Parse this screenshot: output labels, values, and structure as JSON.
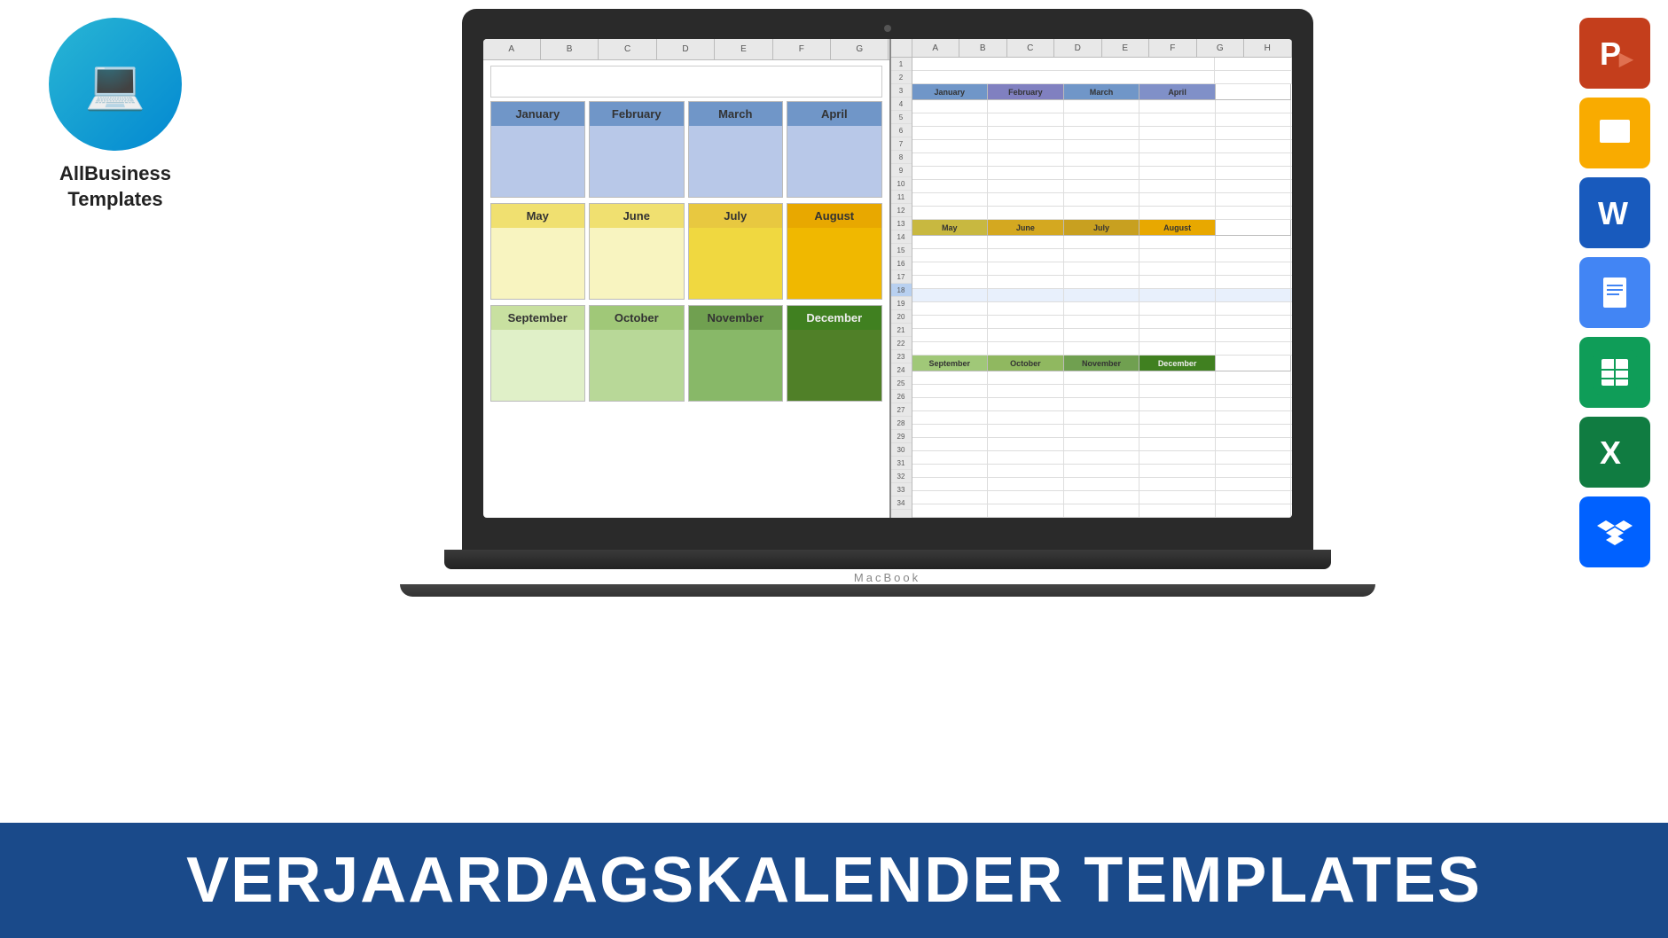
{
  "page": {
    "background": "#ffffff"
  },
  "logo": {
    "circle_color": "#29b6d4",
    "brand_line1": "AllBusiness",
    "brand_line2": "Templates"
  },
  "banner": {
    "text": "VERJAARDAGSKALENDER TEMPLATES"
  },
  "macbook": {
    "brand": "MacBook"
  },
  "left_sheet": {
    "col_headers": [
      "A",
      "B",
      "C",
      "D",
      "E",
      "F",
      "G"
    ],
    "months": [
      {
        "name": "January",
        "style": "blue"
      },
      {
        "name": "February",
        "style": "blue"
      },
      {
        "name": "March",
        "style": "blue"
      },
      {
        "name": "April",
        "style": "blue"
      },
      {
        "name": "May",
        "style": "yellow-light"
      },
      {
        "name": "June",
        "style": "yellow-light"
      },
      {
        "name": "July",
        "style": "yellow"
      },
      {
        "name": "August",
        "style": "gold"
      },
      {
        "name": "September",
        "style": "green-light"
      },
      {
        "name": "October",
        "style": "green-med"
      },
      {
        "name": "November",
        "style": "green"
      },
      {
        "name": "December",
        "style": "green-dark"
      }
    ]
  },
  "right_sheet": {
    "col_headers": [
      "A",
      "B",
      "C",
      "D",
      "E",
      "F",
      "G",
      "H"
    ],
    "months": [
      "January",
      "February",
      "March",
      "April",
      "May",
      "June",
      "July",
      "August",
      "September",
      "October",
      "November",
      "December"
    ],
    "rows": [
      1,
      2,
      3,
      4,
      5,
      6,
      7,
      8,
      9,
      10,
      11,
      12,
      13,
      14,
      15,
      16,
      17,
      18,
      19,
      20,
      21,
      22,
      23,
      24,
      25,
      26,
      27,
      28,
      29,
      30,
      31,
      32,
      33,
      34
    ]
  },
  "app_icons": [
    {
      "name": "PowerPoint",
      "label": "P",
      "style": "ppt"
    },
    {
      "name": "Google Slides",
      "label": "▶",
      "style": "slides"
    },
    {
      "name": "Word",
      "label": "W",
      "style": "word"
    },
    {
      "name": "Google Docs",
      "label": "≡",
      "style": "docs"
    },
    {
      "name": "Google Sheets",
      "label": "⊞",
      "style": "sheets"
    },
    {
      "name": "Excel",
      "label": "X",
      "style": "excel"
    },
    {
      "name": "Dropbox",
      "label": "◇",
      "style": "dropbox"
    }
  ]
}
